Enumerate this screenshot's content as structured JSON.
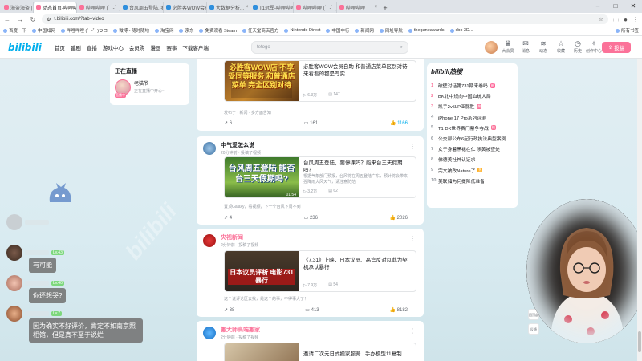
{
  "browser": {
    "tabs": [
      {
        "label": "海盗海盗 | 飞~ 个种~"
      },
      {
        "label": "动态首页-哔哩哔哩",
        "active": true
      },
      {
        "label": "哔哩哔哩 (゜-゜)つロ"
      },
      {
        "label": "台风周五登陆, 看是"
      },
      {
        "label": "必胜客WOW会员卡"
      },
      {
        "label": "大数据分析..."
      },
      {
        "label": "T1冠军-哔哩哔哩"
      },
      {
        "label": "哔哩哔哩 (゜-゜)つロ"
      },
      {
        "label": "哔哩哔哩"
      }
    ],
    "url": "t.bilibili.com/?tab=video",
    "bookmarks": [
      "百度一下",
      "中国知网",
      "哔哩哔哩 (゜-゜)つロ",
      "微博 - 随时随地",
      "淘宝网",
      "京东",
      "免费观看 Steam",
      "任天堂商店官方",
      "Nintendo Direct",
      "中国中行",
      "新闻网",
      "网址导航",
      "theganeawards",
      "cbo 3D...",
      "所有书签"
    ]
  },
  "header": {
    "logo": "bilibili",
    "nav": [
      "首页",
      "番剧",
      "直播",
      "游戏中心",
      "会员购",
      "漫画",
      "赛事",
      "下载客户端"
    ],
    "search_placeholder": "tetogo",
    "user_icons": [
      {
        "icon": "crown-icon",
        "label": "大会员"
      },
      {
        "label": "消息",
        "icon": "mail-icon"
      },
      {
        "label": "动态",
        "icon": "wind-icon"
      },
      {
        "label": "收藏",
        "icon": "star-icon"
      },
      {
        "label": "历史",
        "icon": "clock-icon"
      },
      {
        "label": "创作中心",
        "icon": "bulb-icon"
      }
    ],
    "post_label": "投稿"
  },
  "live": {
    "title": "正在直播",
    "name": "老猫爷",
    "desc": "正在直播中开心~",
    "tag": "直播中"
  },
  "posts": [
    {
      "name": "",
      "time": "",
      "text": "",
      "video_title": "必胜客WOW会员自助 和普通店菜单区别对待 来看看的都是写实",
      "thumb_caption": "必胜客WOW店 不享受同等服务 和普通店菜单 完全区别对待",
      "views": "6.3万",
      "danmaku": "147",
      "duration": "",
      "note": "发布于 · 新闻 · 多方面告知",
      "actions": {
        "share": "6",
        "comment": "161",
        "like": "1166"
      }
    },
    {
      "name": "中气爱怎么说",
      "time": "20分钟前 · 投稿了视频",
      "text": "",
      "video_title": "台风周五登陆，要停课吗？能来台三天假期吗？",
      "video_desc": "根据气象部门预报，台风将在周五登陆广东，预计将会带来强降雨大风天气，请注意防范",
      "thumb_caption": "台风周五登陆 能否台三天假期吗?",
      "views": "3.2万",
      "danmaku": "62",
      "duration": "01:54",
      "note": "置顶Galaxy，看视频，下一个台风下周不到",
      "actions": {
        "share": "4",
        "comment": "236",
        "like": "2026"
      }
    },
    {
      "name": "央视新闻",
      "time": "2分钟前 · 投稿了视频",
      "text": "",
      "video_title": "《7.31》上映，日本议员、高官反对以此为契机承认暴行",
      "video_desc": "",
      "thumb_caption": "日本议员评析 电影731暴行",
      "views": "7.9万",
      "danmaku": "54",
      "duration": "",
      "note": "这个说评论区去找，是这个的事，不得事大了！",
      "actions": {
        "share": "38",
        "comment": "413",
        "like": "8182"
      }
    },
    {
      "name": "搬大师高端搬家",
      "time": "2分钟前 · 投稿了视频",
      "video_title": "邀请二次元日式搬家服务...手办模型11复制",
      "actions": {}
    }
  ],
  "hot": {
    "title": "bilibili热搜",
    "items": [
      {
        "rank": "1",
        "text": "破壁对话第731期来卷吗",
        "badge": "新",
        "badge_class": "b-new"
      },
      {
        "rank": "2",
        "text": "BK北中规向中国血统大局",
        "badge": "",
        "badge_class": ""
      },
      {
        "rank": "3",
        "text": "凯手2v5LP亚豚胜",
        "badge": "热",
        "badge_class": "b-hot"
      },
      {
        "rank": "4",
        "text": "iPhone 17 Pro系列评测",
        "badge": "",
        "badge_class": ""
      },
      {
        "rank": "5",
        "text": "T1 DK世界赛门票争夺战",
        "badge": "热",
        "badge_class": "b-hot"
      },
      {
        "rank": "6",
        "text": "公交部公布6起行政执法典型案例",
        "badge": "",
        "badge_class": ""
      },
      {
        "rank": "7",
        "text": "女子身着黑裙在仁 涉黄被查处",
        "badge": "",
        "badge_class": ""
      },
      {
        "rank": "8",
        "text": "佛德美社神认证求",
        "badge": "",
        "badge_class": ""
      },
      {
        "rank": "9",
        "text": "完文被改Nature了",
        "badge": "热",
        "badge_class": "b-hy"
      },
      {
        "rank": "10",
        "text": "美联储为何提降低准备",
        "badge": "",
        "badge_class": ""
      }
    ]
  },
  "side": {
    "top_label": "回顶部",
    "feedback_label": "反馈"
  },
  "chat": {
    "messages": [
      {
        "text": "有可能"
      },
      {
        "text": "你还想哭?"
      },
      {
        "text": "因为确实不好评价，肯定不如南京照相馆，但是真不至于说烂"
      }
    ],
    "levels": [
      "Lv.43",
      "Lv.40",
      "Lv.7"
    ]
  },
  "colors": {
    "accent": "#00aeec",
    "pink": "#fb7299"
  }
}
